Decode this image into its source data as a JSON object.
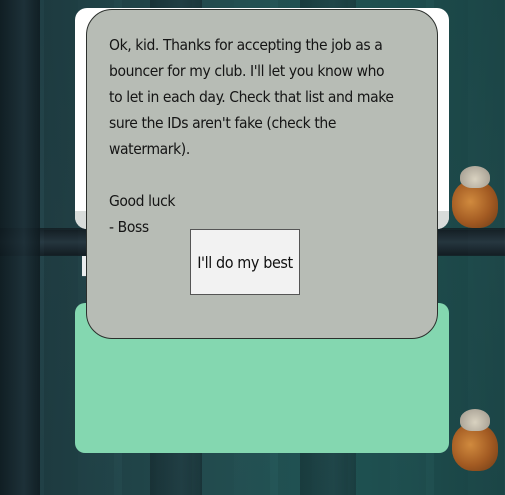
{
  "dialog": {
    "message": "Ok, kid. Thanks for accepting the job as a\nbouncer for my club. I'll let you know who\nto let in each day. Check that list and make\nsure the IDs aren't fake (check the\nwatermark).\n\nGood luck\n- Boss",
    "button_label": "I'll do my best"
  },
  "panels": {
    "green_panel_color": "#84d7b0",
    "dialog_color": "#b7bcb5"
  },
  "background": {
    "decor_icons": [
      "paw-icon",
      "critter-sprite"
    ]
  }
}
